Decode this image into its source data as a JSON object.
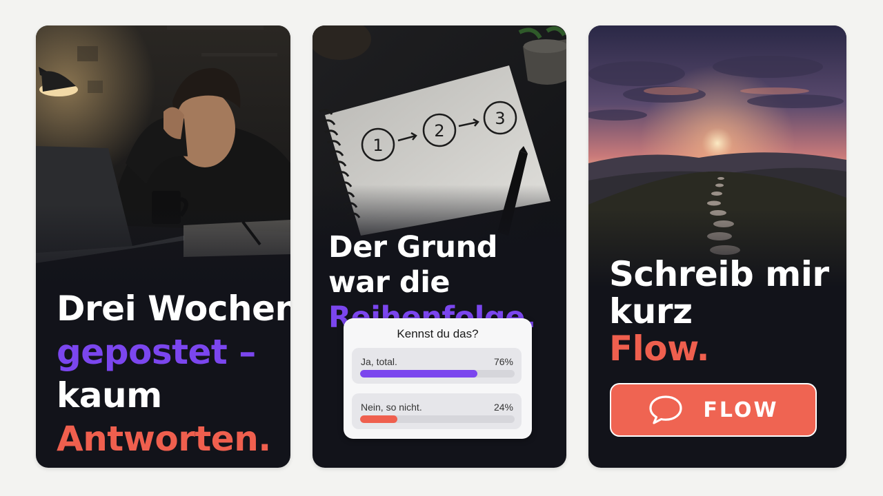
{
  "cards": [
    {
      "headline": [
        {
          "text": "Drei Wochen"
        },
        {
          "text": "gepostet –"
        },
        {
          "text": "kaum"
        },
        {
          "text": "Antworten."
        }
      ]
    },
    {
      "headline": [
        {
          "text": "Der Grund"
        },
        {
          "text": "war die"
        },
        {
          "text": "Reihenfolge."
        }
      ],
      "notebook_steps": [
        "1",
        "2",
        "3"
      ],
      "poll": {
        "question": "Kennst du das?",
        "options": [
          {
            "label": "Ja, total.",
            "percent_text": "76%",
            "percent": 76,
            "color": "#7b46ee"
          },
          {
            "label": "Nein, so nicht.",
            "percent_text": "24%",
            "percent": 24,
            "color": "#ef5f4e"
          }
        ]
      }
    },
    {
      "headline": [
        {
          "text": "Schreib mir"
        },
        {
          "text": "kurz"
        },
        {
          "text": "Flow."
        }
      ],
      "cta": {
        "label": "FLOW",
        "icon": "speech-bubble-icon"
      }
    }
  ],
  "colors": {
    "accent_purple": "#7b46ee",
    "accent_coral": "#ef5f4e",
    "card_background": "#12131a"
  }
}
